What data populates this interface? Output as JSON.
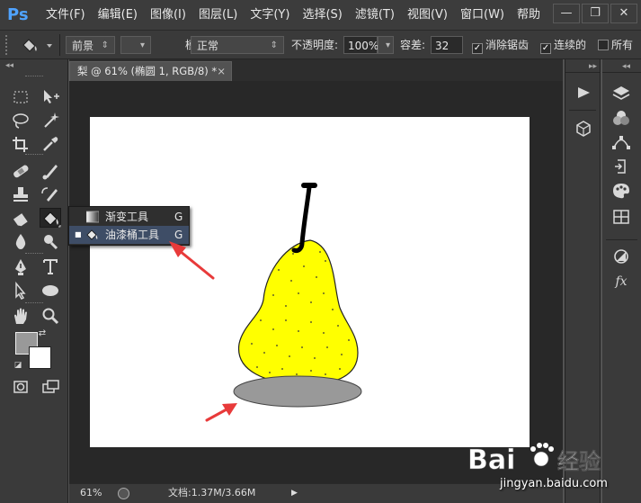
{
  "app": {
    "logo": "Ps"
  },
  "menu": [
    "文件(F)",
    "编辑(E)",
    "图像(I)",
    "图层(L)",
    "文字(Y)",
    "选择(S)",
    "滤镜(T)",
    "视图(V)",
    "窗口(W)",
    "帮助"
  ],
  "window_controls": {
    "minimize": "—",
    "restore": "❐",
    "close": "✕"
  },
  "options": {
    "fill_source": "前景",
    "mode_label": "模式:",
    "mode_value": "正常",
    "opacity_label": "不透明度:",
    "opacity_value": "100%",
    "tolerance_label": "容差:",
    "tolerance_value": "32",
    "antialias_label": "消除锯齿",
    "antialias_checked": true,
    "contiguous_label": "连续的",
    "contiguous_checked": true,
    "all_layers_label": "所有",
    "all_layers_checked": false
  },
  "document": {
    "tab_title": "梨 @ 61% (椭圆 1, RGB/8) *",
    "close": "×"
  },
  "tool_flyout": {
    "items": [
      {
        "label": "渐变工具",
        "shortcut": "G",
        "selected": false
      },
      {
        "label": "油漆桶工具",
        "shortcut": "G",
        "selected": true
      }
    ]
  },
  "colors": {
    "foreground": "#999999",
    "background": "#ffffff",
    "pear_fill": "#ffff00",
    "shadow_fill": "#999999",
    "arrow": "#e83a3a",
    "accent": "#4fa3ff"
  },
  "status": {
    "zoom": "61%",
    "doc_info": "文档:1.37M/3.66M"
  },
  "watermark": {
    "brand": "Bai",
    "brand2": "经验",
    "url": "jingyan.baidu.com"
  }
}
